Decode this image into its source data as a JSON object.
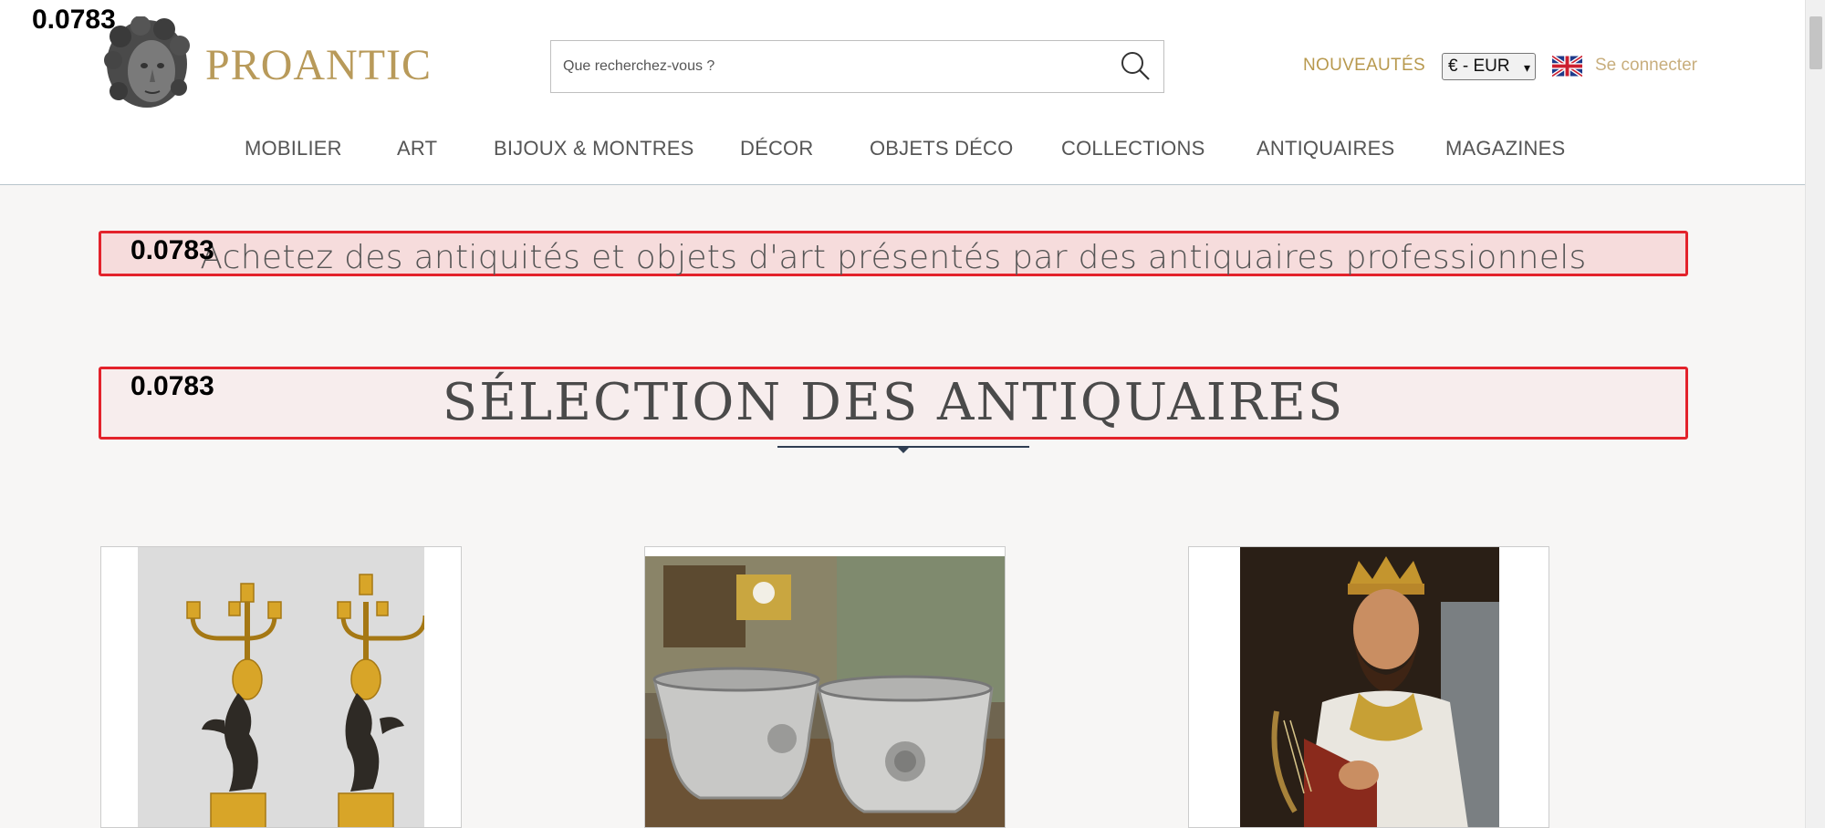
{
  "score_labels": {
    "top_left": "0.0783",
    "tagline": "0.0783",
    "title": "0.0783"
  },
  "brand": {
    "name": "PROANTIC"
  },
  "search": {
    "placeholder": "Que recherchez-vous ?"
  },
  "header": {
    "nouveautes": "NOUVEAUTÉS",
    "currency": "€ - EUR",
    "login": "Se connecter"
  },
  "nav": {
    "items": [
      {
        "label": "MOBILIER"
      },
      {
        "label": "ART"
      },
      {
        "label": "BIJOUX & MONTRES"
      },
      {
        "label": "DÉCOR"
      },
      {
        "label": "OBJETS DÉCO"
      },
      {
        "label": "COLLECTIONS"
      },
      {
        "label": "ANTIQUAIRES"
      },
      {
        "label": "MAGAZINES"
      }
    ]
  },
  "main": {
    "tagline": "Achetez des antiquités et objets d'art présentés par des antiquaires professionnels",
    "section_title": "SÉLECTION DES ANTIQUAIRES"
  },
  "colors": {
    "brand_gold": "#b89a5a",
    "highlight_red": "#e3222b",
    "nav_text": "#555555",
    "page_bg": "#f7f6f5"
  }
}
